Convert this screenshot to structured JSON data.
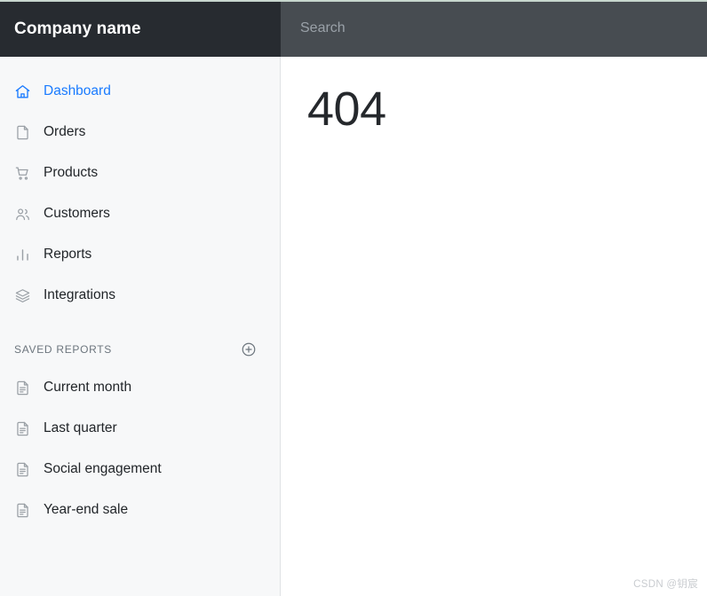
{
  "brand": {
    "title": "Company name"
  },
  "search": {
    "placeholder": "Search",
    "value": ""
  },
  "sidebar": {
    "nav_items": [
      {
        "label": "Dashboard",
        "icon": "home-icon",
        "active": true
      },
      {
        "label": "Orders",
        "icon": "file-icon",
        "active": false
      },
      {
        "label": "Products",
        "icon": "cart-icon",
        "active": false
      },
      {
        "label": "Customers",
        "icon": "users-icon",
        "active": false
      },
      {
        "label": "Reports",
        "icon": "bar-chart-icon",
        "active": false
      },
      {
        "label": "Integrations",
        "icon": "layers-icon",
        "active": false
      }
    ],
    "saved_reports": {
      "section_title": "Saved reports",
      "add_label": "+",
      "items": [
        {
          "label": "Current month",
          "icon": "document-icon"
        },
        {
          "label": "Last quarter",
          "icon": "document-icon"
        },
        {
          "label": "Social engagement",
          "icon": "document-icon"
        },
        {
          "label": "Year-end sale",
          "icon": "document-icon"
        }
      ]
    }
  },
  "main": {
    "error_code": "404"
  },
  "watermark": {
    "text": "CSDN @钥宸"
  },
  "colors": {
    "brand_bar": "#272b30",
    "search_bar": "#474c51",
    "sidebar_bg": "#f7f8f9",
    "accent": "#1a7bff",
    "muted_text": "#6c757d",
    "icon_grey": "#9aa0a6",
    "text": "#212529"
  }
}
